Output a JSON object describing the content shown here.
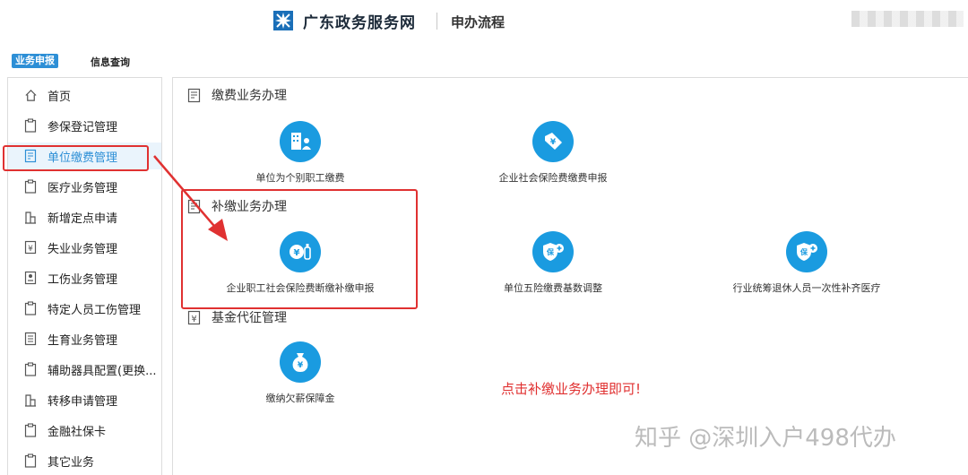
{
  "header": {
    "brand": "广东政务服务网",
    "subtitle": "申办流程"
  },
  "tabs": [
    {
      "label": "业务申报",
      "active": true
    },
    {
      "label": "信息查询",
      "active": false
    }
  ],
  "sidebar": {
    "items": [
      {
        "label": "首页",
        "icon": "home-icon"
      },
      {
        "label": "参保登记管理",
        "icon": "clipboard-icon"
      },
      {
        "label": "单位缴费管理",
        "icon": "form-icon",
        "active": true
      },
      {
        "label": "医疗业务管理",
        "icon": "clipboard-icon"
      },
      {
        "label": "新增定点申请",
        "icon": "building-icon"
      },
      {
        "label": "失业业务管理",
        "icon": "yen-doc-icon"
      },
      {
        "label": "工伤业务管理",
        "icon": "id-card-icon"
      },
      {
        "label": "特定人员工伤管理",
        "icon": "clipboard-icon"
      },
      {
        "label": "生育业务管理",
        "icon": "doc-icon"
      },
      {
        "label": "辅助器具配置(更换...",
        "icon": "clipboard-icon"
      },
      {
        "label": "转移申请管理",
        "icon": "building-icon"
      },
      {
        "label": "金融社保卡",
        "icon": "clipboard-icon"
      },
      {
        "label": "其它业务",
        "icon": "clipboard-icon"
      }
    ]
  },
  "sections": [
    {
      "title": "缴费业务办理",
      "icon": "form-icon"
    },
    {
      "title": "补缴业务办理",
      "icon": "form-icon"
    },
    {
      "title": "基金代征管理",
      "icon": "yen-icon"
    }
  ],
  "services": [
    {
      "label": "单位为个别职工缴费",
      "icon": "building-person-icon"
    },
    {
      "label": "企业社会保险费缴费申报",
      "icon": "yen-tag-icon"
    },
    {
      "label": "企业职工社会保险费断缴补缴申报",
      "icon": "yen-bottle-icon"
    },
    {
      "label": "单位五险缴费基数调整",
      "icon": "shield-plus-icon"
    },
    {
      "label": "行业统筹退休人员一次性补齐医疗",
      "icon": "shield-plus-icon"
    },
    {
      "label": "缴纳欠薪保障金",
      "icon": "money-bag-icon"
    }
  ],
  "annotation": "点击补缴业务办理即可!",
  "watermark": "知乎 @深圳入户498代办",
  "colors": {
    "accent": "#1a9be0",
    "highlight": "#e03131",
    "tab_active": "#2d8fd6"
  }
}
